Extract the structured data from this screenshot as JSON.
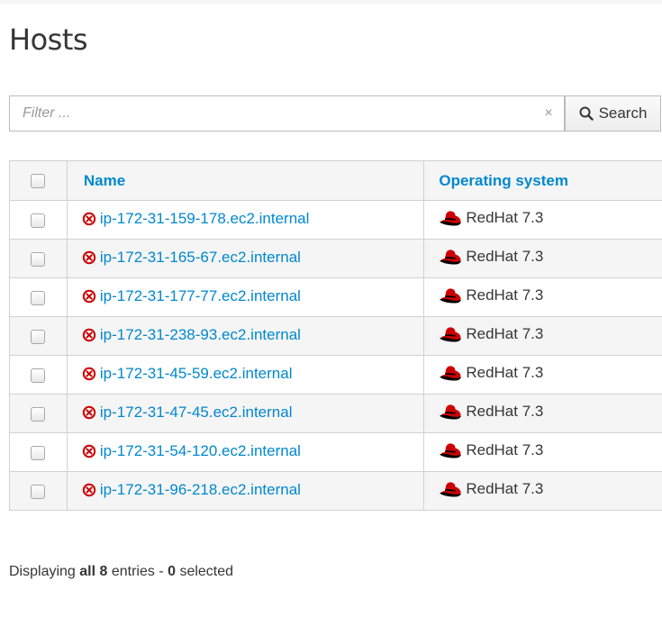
{
  "page": {
    "title": "Hosts"
  },
  "search": {
    "placeholder": "Filter ...",
    "value": "",
    "clear_glyph": "×",
    "button_label": "Search",
    "button_icon": "search-icon"
  },
  "table": {
    "columns": {
      "name": "Name",
      "os": "Operating system"
    },
    "rows": [
      {
        "name": "ip-172-31-159-178.ec2.internal",
        "status_icon": "error-circle-icon",
        "os": "RedHat 7.3",
        "os_icon": "redhat-icon"
      },
      {
        "name": "ip-172-31-165-67.ec2.internal",
        "status_icon": "error-circle-icon",
        "os": "RedHat 7.3",
        "os_icon": "redhat-icon"
      },
      {
        "name": "ip-172-31-177-77.ec2.internal",
        "status_icon": "error-circle-icon",
        "os": "RedHat 7.3",
        "os_icon": "redhat-icon"
      },
      {
        "name": "ip-172-31-238-93.ec2.internal",
        "status_icon": "error-circle-icon",
        "os": "RedHat 7.3",
        "os_icon": "redhat-icon"
      },
      {
        "name": "ip-172-31-45-59.ec2.internal",
        "status_icon": "error-circle-icon",
        "os": "RedHat 7.3",
        "os_icon": "redhat-icon"
      },
      {
        "name": "ip-172-31-47-45.ec2.internal",
        "status_icon": "error-circle-icon",
        "os": "RedHat 7.3",
        "os_icon": "redhat-icon"
      },
      {
        "name": "ip-172-31-54-120.ec2.internal",
        "status_icon": "error-circle-icon",
        "os": "RedHat 7.3",
        "os_icon": "redhat-icon"
      },
      {
        "name": "ip-172-31-96-218.ec2.internal",
        "status_icon": "error-circle-icon",
        "os": "RedHat 7.3",
        "os_icon": "redhat-icon"
      }
    ]
  },
  "footer": {
    "prefix": "Displaying ",
    "scope": "all 8",
    "middle": " entries - ",
    "selected_count": "0",
    "suffix": " selected"
  },
  "colors": {
    "link": "#0088ce",
    "error": "#cc0000",
    "border": "#d1d1d1",
    "stripe": "#f5f5f5"
  }
}
